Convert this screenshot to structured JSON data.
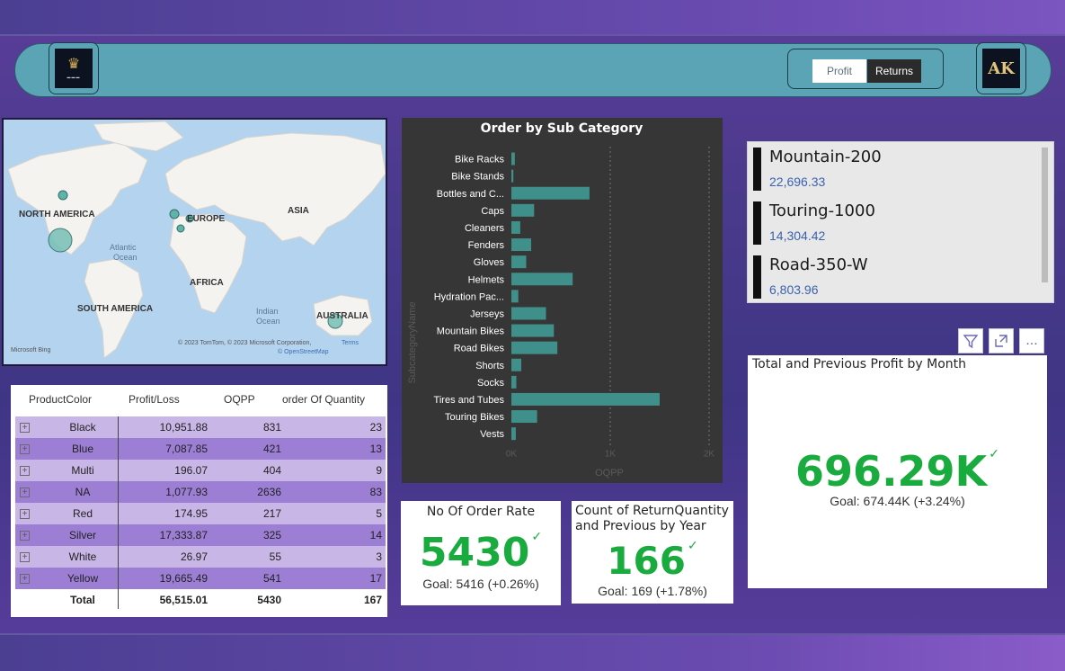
{
  "header": {
    "toggle": {
      "profit_label": "Profit",
      "returns_label": "Returns"
    },
    "right_logo_text": "AK"
  },
  "map": {
    "labels": {
      "north_america": "NORTH AMERICA",
      "europe": "EUROPE",
      "asia": "ASIA",
      "atlantic1": "Atlantic",
      "atlantic2": "Ocean",
      "africa": "AFRICA",
      "south_america": "SOUTH AMERICA",
      "indian1": "Indian",
      "indian2": "Ocean",
      "australia": "AUSTRALIA"
    },
    "bing": "Microsoft Bing",
    "copyright": "© 2023 TomTom, © 2023 Microsoft Corporation,",
    "terms": "Terms",
    "osm": "© OpenStreetMap"
  },
  "chart_data": {
    "type": "bar",
    "orientation": "horizontal",
    "title": "Order by Sub Category",
    "ylabel": "SubcategoryName",
    "xlabel": "OQPP",
    "categories": [
      "Bike Racks",
      "Bike Stands",
      "Bottles and C...",
      "Caps",
      "Cleaners",
      "Fenders",
      "Gloves",
      "Helmets",
      "Hydration Pac...",
      "Jerseys",
      "Mountain Bikes",
      "Road Bikes",
      "Shorts",
      "Socks",
      "Tires and Tubes",
      "Touring Bikes",
      "Vests"
    ],
    "values": [
      35,
      20,
      790,
      230,
      90,
      200,
      150,
      620,
      70,
      350,
      430,
      465,
      100,
      50,
      1500,
      260,
      45
    ],
    "xlim": [
      0,
      2000
    ],
    "xticks": [
      "0K",
      "1K",
      "2K"
    ],
    "grid": true,
    "bar_color": "#3f8f8a"
  },
  "top_products": [
    {
      "name": "Mountain-200",
      "value": "22,696.33"
    },
    {
      "name": "Touring-1000",
      "value": "14,304.42"
    },
    {
      "name": "Road-350-W",
      "value": "6,803.96"
    }
  ],
  "visual_header": {
    "filter_icon": "filter-icon",
    "focus_icon": "focus-mode-icon",
    "more_icon": "more-options-icon",
    "more_label": "..."
  },
  "kpi_profit": {
    "title": "Total and Previous Profit by Month",
    "value": "696.29K",
    "check": "✓",
    "goal": "Goal: 674.44K (+3.24%)"
  },
  "kpi_orders": {
    "title": "No Of Order Rate",
    "value": "5430",
    "check": "✓",
    "goal": "Goal: 5416 (+0.26%)"
  },
  "kpi_returns": {
    "title_line1": "Count of ReturnQuantity",
    "title_line2": "and Previous by Year",
    "value": "166",
    "check": "✓",
    "goal": "Goal: 169 (+1.78%)"
  },
  "table": {
    "headers": [
      "ProductColor",
      "Profit/Loss",
      "OQPP",
      "order Of Quantity"
    ],
    "rows": [
      [
        "Black",
        "10,951.88",
        "831",
        "23"
      ],
      [
        "Blue",
        "7,087.85",
        "421",
        "13"
      ],
      [
        "Multi",
        "196.07",
        "404",
        "9"
      ],
      [
        "NA",
        "1,077.93",
        "2636",
        "83"
      ],
      [
        "Red",
        "174.95",
        "217",
        "5"
      ],
      [
        "Silver",
        "17,333.87",
        "325",
        "14"
      ],
      [
        "White",
        "26.97",
        "55",
        "3"
      ],
      [
        "Yellow",
        "19,665.49",
        "541",
        "17"
      ]
    ],
    "total": [
      "Total",
      "56,515.01",
      "5430",
      "167"
    ],
    "expand_glyph": "+"
  }
}
